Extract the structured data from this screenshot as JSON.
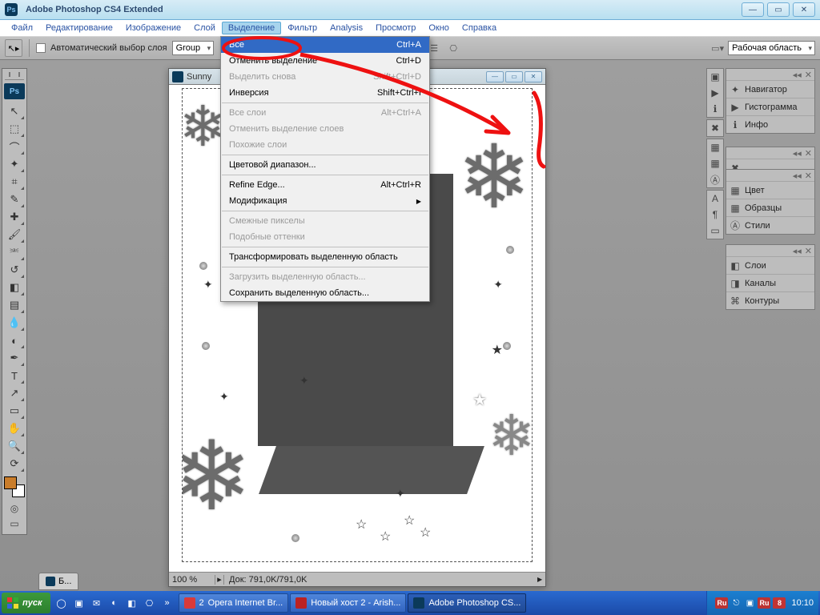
{
  "title": "Adobe Photoshop CS4 Extended",
  "menubar": [
    "Файл",
    "Редактирование",
    "Изображение",
    "Слой",
    "Выделение",
    "Фильтр",
    "Analysis",
    "Просмотр",
    "Окно",
    "Справка"
  ],
  "menubar_active_index": 4,
  "optbar": {
    "auto_select_label": "Автоматический выбор слоя",
    "group_label": "Group",
    "workspace_label": "Рабочая область"
  },
  "dropdown": {
    "items": [
      {
        "label": "Все",
        "shortcut": "Ctrl+A",
        "hl": true
      },
      {
        "label": "Отменить выделение",
        "shortcut": "Ctrl+D"
      },
      {
        "label": "Выделить снова",
        "shortcut": "Shift+Ctrl+D",
        "dis": true
      },
      {
        "label": "Инверсия",
        "shortcut": "Shift+Ctrl+I"
      },
      {
        "sep": true
      },
      {
        "label": "Все слои",
        "shortcut": "Alt+Ctrl+A",
        "dis": true
      },
      {
        "label": "Отменить выделение слоев",
        "dis": true
      },
      {
        "label": "Похожие слои",
        "dis": true
      },
      {
        "sep": true
      },
      {
        "label": "Цветовой диапазон..."
      },
      {
        "sep": true
      },
      {
        "label": "Refine Edge...",
        "shortcut": "Alt+Ctrl+R"
      },
      {
        "label": "Модификация",
        "sub": true
      },
      {
        "sep": true
      },
      {
        "label": "Смежные пикселы",
        "dis": true
      },
      {
        "label": "Подобные оттенки",
        "dis": true
      },
      {
        "sep": true
      },
      {
        "label": "Трансформировать выделенную область"
      },
      {
        "sep": true
      },
      {
        "label": "Загрузить выделенную область...",
        "dis": true
      },
      {
        "label": "Сохранить выделенную область..."
      }
    ]
  },
  "document": {
    "title_short": "Sunny",
    "zoom": "100 %",
    "doc_info": "Док: 791,0K/791,0K",
    "tab_label": "Б..."
  },
  "toolbox_tools": [
    "move",
    "marquee",
    "lasso",
    "wand",
    "crop",
    "eyedropper",
    "heal",
    "brush",
    "stamp",
    "history-brush",
    "eraser",
    "gradient",
    "blur",
    "dodge",
    "pen",
    "type",
    "path-sel",
    "rectangle",
    "hand",
    "zoom",
    "rotate-view"
  ],
  "toolbox_glyphs": [
    "↖",
    "⬚",
    "⌒",
    "✦",
    "⌗",
    "✎",
    "✚",
    "🖌",
    "⎃",
    "↺",
    "◧",
    "▤",
    "💧",
    "◐",
    "✒",
    "T",
    "↗",
    "▭",
    "✋",
    "🔍",
    "⟳"
  ],
  "panels": {
    "group1": [
      {
        "icon": "✦",
        "label": "Навигатор"
      },
      {
        "icon": "▶",
        "label": "Гистограмма"
      },
      {
        "icon": "ℹ",
        "label": "Инфо"
      }
    ],
    "group2": [
      {
        "icon": "✖",
        "label": ""
      }
    ],
    "group3": [
      {
        "icon": "▦",
        "label": "Цвет"
      },
      {
        "icon": "▦",
        "label": "Образцы"
      },
      {
        "icon": "Ⓐ",
        "label": "Стили"
      }
    ],
    "group4": [
      {
        "icon": "◧",
        "label": "Слои"
      },
      {
        "icon": "◨",
        "label": "Каналы"
      },
      {
        "icon": "⌘",
        "label": "Контуры"
      }
    ]
  },
  "strip_icons": [
    [
      "▣",
      "▶",
      "ℹ"
    ],
    [
      "✖"
    ],
    [
      "▦",
      "▦",
      "Ⓐ"
    ],
    [
      "A",
      "¶",
      "▭"
    ]
  ],
  "taskbar": {
    "start": "пуск",
    "tasks": [
      {
        "num": "2",
        "label": "Opera Internet Br...",
        "color": "#d93a3a"
      },
      {
        "label": "Новый хост 2 - Arish...",
        "color": "#b22"
      },
      {
        "label": "Adobe Photoshop CS...",
        "color": "#0b3a5a",
        "active": true
      }
    ],
    "clock": "10:10",
    "lang": "Ru",
    "tray_badge": "8"
  }
}
